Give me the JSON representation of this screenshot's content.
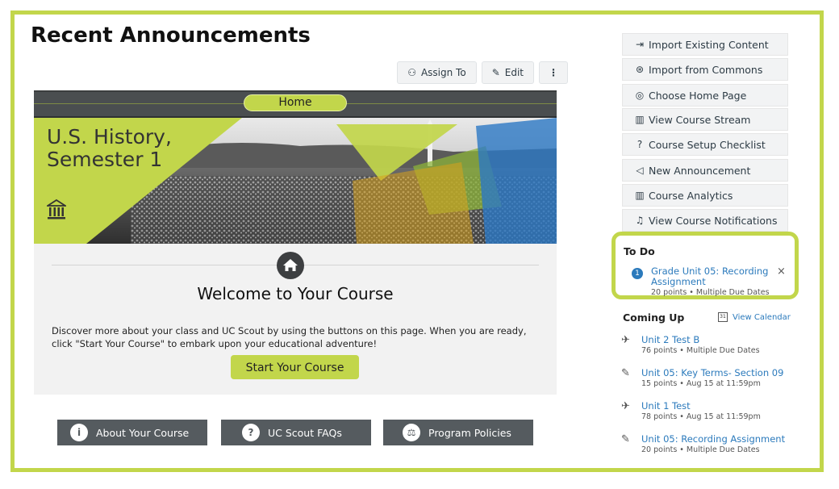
{
  "page": {
    "title": "Recent Announcements"
  },
  "toolbar": {
    "assign_label": "Assign To",
    "edit_label": "Edit",
    "more_label": "⋮"
  },
  "banner": {
    "home_label": "Home",
    "course_title_line1": "U.S. History,",
    "course_title_line2": "Semester 1"
  },
  "welcome": {
    "heading": "Welcome to Your Course",
    "body": "Discover more about your class and UC Scout by using the buttons on this page. When you are ready, click \"Start Your Course\" to embark upon your educational adventure!",
    "start_button": "Start Your Course"
  },
  "bottom_buttons": [
    {
      "label": "About Your Course",
      "icon": "info-icon"
    },
    {
      "label": "UC Scout FAQs",
      "icon": "question-icon"
    },
    {
      "label": "Program Policies",
      "icon": "scale-icon"
    }
  ],
  "sidebar": {
    "buttons": [
      {
        "label": "Import Existing Content",
        "icon": "import-icon"
      },
      {
        "label": "Import from Commons",
        "icon": "commons-icon"
      },
      {
        "label": "Choose Home Page",
        "icon": "target-icon"
      },
      {
        "label": "View Course Stream",
        "icon": "bar-chart-icon"
      },
      {
        "label": "Course Setup Checklist",
        "icon": "question-circle-icon"
      },
      {
        "label": "New Announcement",
        "icon": "megaphone-icon"
      },
      {
        "label": "Course Analytics",
        "icon": "bar-chart-icon"
      },
      {
        "label": "View Course Notifications",
        "icon": "bell-icon"
      }
    ]
  },
  "todo": {
    "title": "To Do",
    "badge": "1",
    "item_title": "Grade Unit 05: Recording Assignment",
    "item_meta": "20 points • Multiple Due Dates",
    "close": "×"
  },
  "coming_up": {
    "title": "Coming Up",
    "calendar_link": "View Calendar",
    "calendar_icon_text": "31",
    "items": [
      {
        "title": "Unit 2 Test B",
        "meta": "76 points • Multiple Due Dates",
        "icon": "rocket-icon"
      },
      {
        "title": "Unit 05: Key Terms- Section 09",
        "meta": "15 points • Aug 15 at 11:59pm",
        "icon": "assignment-icon"
      },
      {
        "title": "Unit 1 Test",
        "meta": "78 points • Aug 15 at 11:59pm",
        "icon": "rocket-icon"
      },
      {
        "title": "Unit 05: Recording Assignment",
        "meta": "20 points • Multiple Due Dates",
        "icon": "assignment-icon"
      }
    ]
  },
  "colors": {
    "accent": "#c2d64b",
    "link": "#2b7abc",
    "dark_button": "#555b5f"
  }
}
